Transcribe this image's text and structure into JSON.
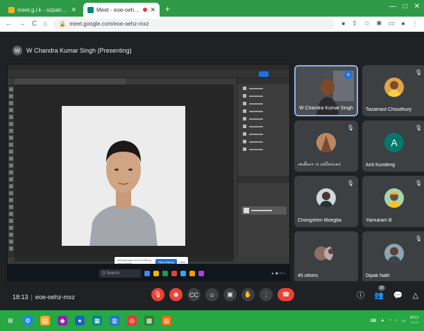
{
  "browser": {
    "tabs": [
      {
        "title": "meet.g.l.k - ozpann0.00001",
        "active": false,
        "favicon_color": "#f6b026"
      },
      {
        "title": "Meet - eoe-oehz-mxz",
        "active": true,
        "favicon_color": "#00897b"
      }
    ],
    "new_tab_label": "+",
    "address": "meet.google.com/eoe-oehz-mxz",
    "window_controls": [
      "—",
      "□",
      "✕"
    ]
  },
  "meet": {
    "presenter_label": "W Chandra Kumar Singh (Presenting)",
    "share_notice": {
      "text": "meet.google.com is sharing your screen",
      "stop_label": "Stop sharing",
      "hide_label": "Hide"
    },
    "shared_taskbar_search": "Q Search",
    "participants": [
      {
        "name": "W Chandra Kumar Singh",
        "type": "video",
        "active": true,
        "avatar_color": "#b5651d"
      },
      {
        "name": "Tazamaul Choudhury",
        "type": "photo",
        "avatar_color": "#e0a24a"
      },
      {
        "name": "அகிலா ம ரவிசங்கர்",
        "type": "photo",
        "avatar_color": "#9e6b4a"
      },
      {
        "name": "Anti Kundeng",
        "type": "letter",
        "letter": "A",
        "avatar_color": "#00796b"
      },
      {
        "name": "Chongshen Moegba",
        "type": "photo",
        "avatar_color": "#5d4037"
      },
      {
        "name": "Yamukam B",
        "type": "photo",
        "avatar_color": "#d4a017"
      },
      {
        "name": "45 others",
        "type": "group",
        "avatar_color": "#8d6e63"
      },
      {
        "name": "Dipak Nath",
        "type": "photo",
        "avatar_color": "#6d4c41"
      }
    ],
    "meeting_time": "18:13",
    "meeting_code": "eoe-oehz-mxz",
    "people_count": "50",
    "colors": {
      "hangup": "#ea4335",
      "accent": "#1a73e8",
      "taskbar": "#28a745"
    }
  }
}
